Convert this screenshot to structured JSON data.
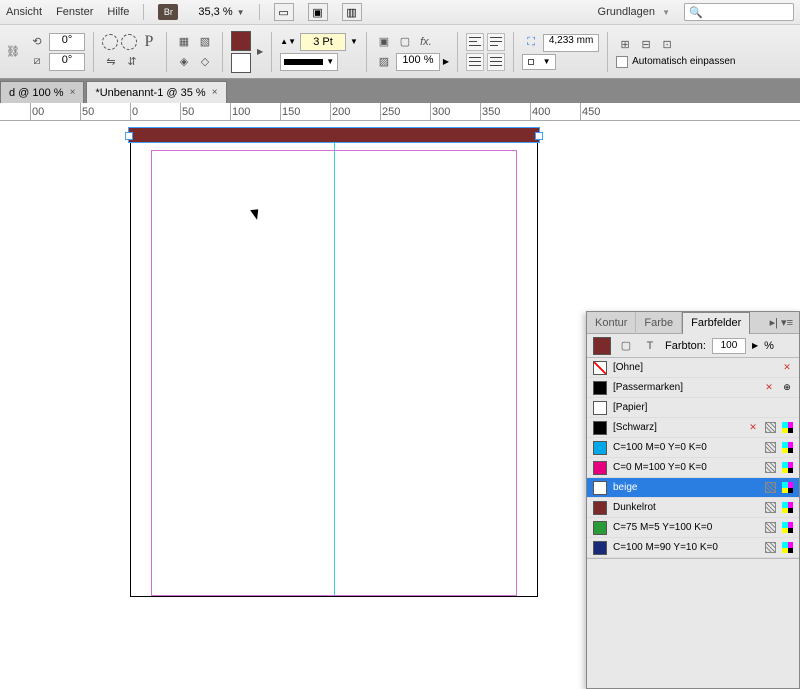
{
  "menu": {
    "ansicht": "Ansicht",
    "fenster": "Fenster",
    "hilfe": "Hilfe",
    "zoom": "35,3 %",
    "workspace": "Grundlagen"
  },
  "control": {
    "angle1": "0°",
    "angle2": "0°",
    "stroke_value": "3 Pt",
    "opacity": "100 %",
    "dim": "4,233 mm",
    "autofit": "Automatisch einpassen"
  },
  "tabs": [
    {
      "label": "d @ 100 %"
    },
    {
      "label": "*Unbenannt-1 @ 35 %"
    }
  ],
  "ruler": [
    "00",
    "50",
    "0",
    "50",
    "100",
    "150",
    "200",
    "250",
    "300",
    "350",
    "400",
    "450"
  ],
  "panel": {
    "tabs": {
      "kontur": "Kontur",
      "farbe": "Farbe",
      "farbfelder": "Farbfelder"
    },
    "tint_label": "Farbton:",
    "tint_value": "100",
    "tint_unit": "%"
  },
  "swatches": [
    {
      "name": "[Ohne]",
      "color": "none",
      "lock": true
    },
    {
      "name": "[Passermarken]",
      "color": "#000",
      "lock": true,
      "reg": true
    },
    {
      "name": "[Papier]",
      "color": "#fff"
    },
    {
      "name": "[Schwarz]",
      "color": "#000",
      "lock": true,
      "cmyk": true
    },
    {
      "name": "C=100 M=0 Y=0 K=0",
      "color": "#00A8E8",
      "cmyk": true
    },
    {
      "name": "C=0 M=100 Y=0 K=0",
      "color": "#E6007E",
      "cmyk": true
    },
    {
      "name": "beige",
      "color": "#fff",
      "cmyk": true,
      "selected": true
    },
    {
      "name": "Dunkelrot",
      "color": "#7a2a2a",
      "cmyk": true
    },
    {
      "name": "C=75 M=5 Y=100 K=0",
      "color": "#2b9b3a",
      "cmyk": true
    },
    {
      "name": "C=100 M=90 Y=10 K=0",
      "color": "#1a2a7a",
      "cmyk": true
    }
  ]
}
